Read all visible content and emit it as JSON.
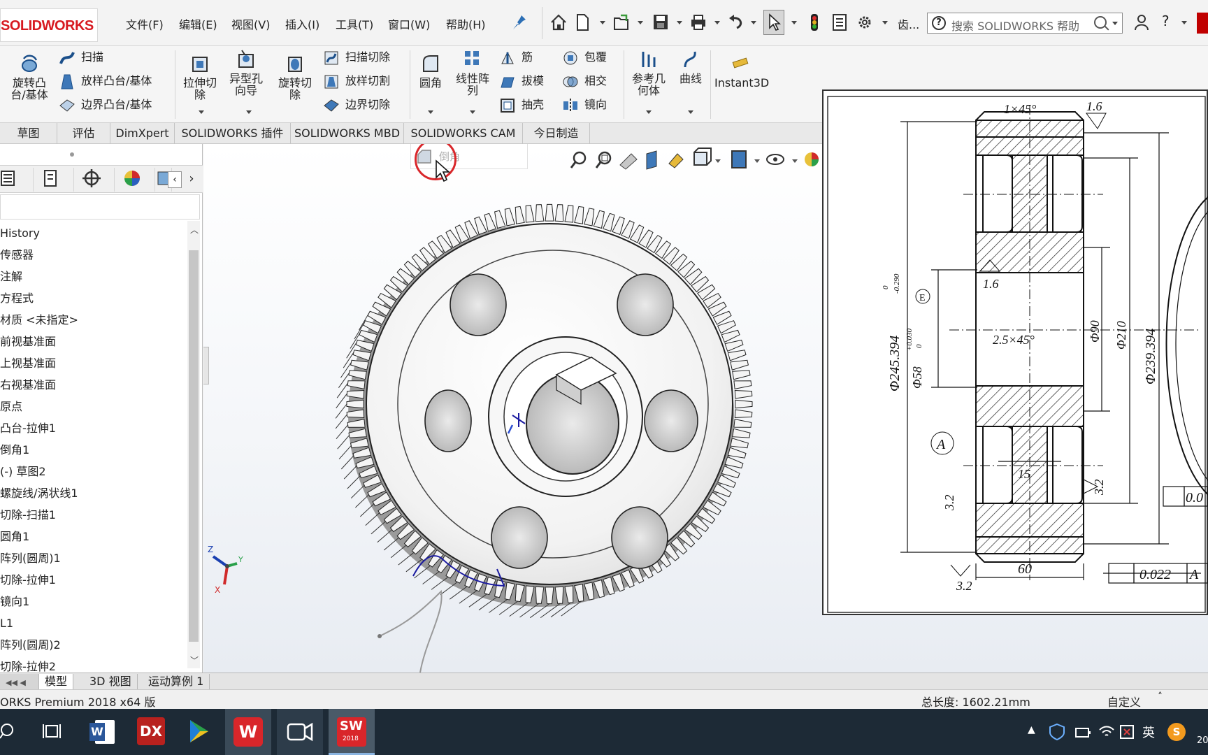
{
  "app": {
    "logo": "SOLIDWORKS"
  },
  "menu": {
    "items": [
      "文件(F)",
      "编辑(E)",
      "视图(V)",
      "插入(I)",
      "工具(T)",
      "窗口(W)",
      "帮助(H)"
    ],
    "truncated_label": "齿...",
    "help_label": "?",
    "search_placeholder": "搜索 SOLIDWORKS 帮助"
  },
  "ribbon": {
    "revolve_boss": "旋转凸台/基体",
    "sweep": "扫描",
    "loft_boss": "放样凸台/基体",
    "boundary_boss": "边界凸台/基体",
    "extruded_cut": "拉伸切除",
    "hole_wizard": "异型孔向导",
    "revolved_cut": "旋转切除",
    "swept_cut": "扫描切除",
    "lofted_cut": "放样切割",
    "boundary_cut": "边界切除",
    "fillet": "圆角",
    "linear_pattern": "线性阵列",
    "rib": "筋",
    "draft": "拔模",
    "shell": "抽壳",
    "wrap": "包覆",
    "intersect": "相交",
    "mirror": "镜向",
    "reference_geometry": "参考几何体",
    "curves": "曲线",
    "instant3d": "Instant3D"
  },
  "tabs": [
    "草图",
    "评估",
    "DimXpert",
    "SOLIDWORKS 插件",
    "SOLIDWORKS MBD",
    "SOLIDWORKS CAM",
    "今日制造"
  ],
  "tooltip": {
    "label": "倒角"
  },
  "feature_tree": {
    "items": [
      "History",
      "传感器",
      "注解",
      "方程式",
      "材质 <未指定>",
      "前视基准面",
      "上视基准面",
      "右视基准面",
      "原点",
      "凸台-拉伸1",
      "倒角1",
      "(-) 草图2",
      "螺旋线/涡状线1",
      "切除-扫描1",
      "圆角1",
      "阵列(圆周)1",
      "切除-拉伸1",
      "镜向1",
      "L1",
      "阵列(圆周)2",
      "切除-拉伸2"
    ]
  },
  "bottom_tabs": [
    "模型",
    "3D 视图",
    "运动算例 1"
  ],
  "status": {
    "left": "ORKS Premium 2018 x64 版",
    "length": "总长度: 1602.21mm",
    "custom": "自定义"
  },
  "triad": {
    "x": "X",
    "y": "Y",
    "z": "Z"
  },
  "drawing": {
    "dims": {
      "chamfer_top": "1×45°",
      "roughness_top": "1.6",
      "roughness_mid": "1.6",
      "chamfer_mid": "2.5×45°",
      "bore": "Φ58",
      "bore_tol_upper": "+0.030",
      "bore_tol_lower": "0",
      "datum": "A",
      "datum_e": "E",
      "outer": "Φ245.394",
      "outer_tol_upper": "0",
      "outer_tol_lower": "-0.290",
      "hub": "Φ90",
      "d210": "Φ210",
      "d239": "Φ239.394",
      "web": "15",
      "width": "60",
      "roughness_left": "3.2",
      "roughness_right": "3.2",
      "roughness_bottom": "3.2",
      "runout": "0.022",
      "runout_datum": "A",
      "flatness": "0.0"
    }
  },
  "taskbar": {
    "ime": "英",
    "clock_partial": "20"
  }
}
